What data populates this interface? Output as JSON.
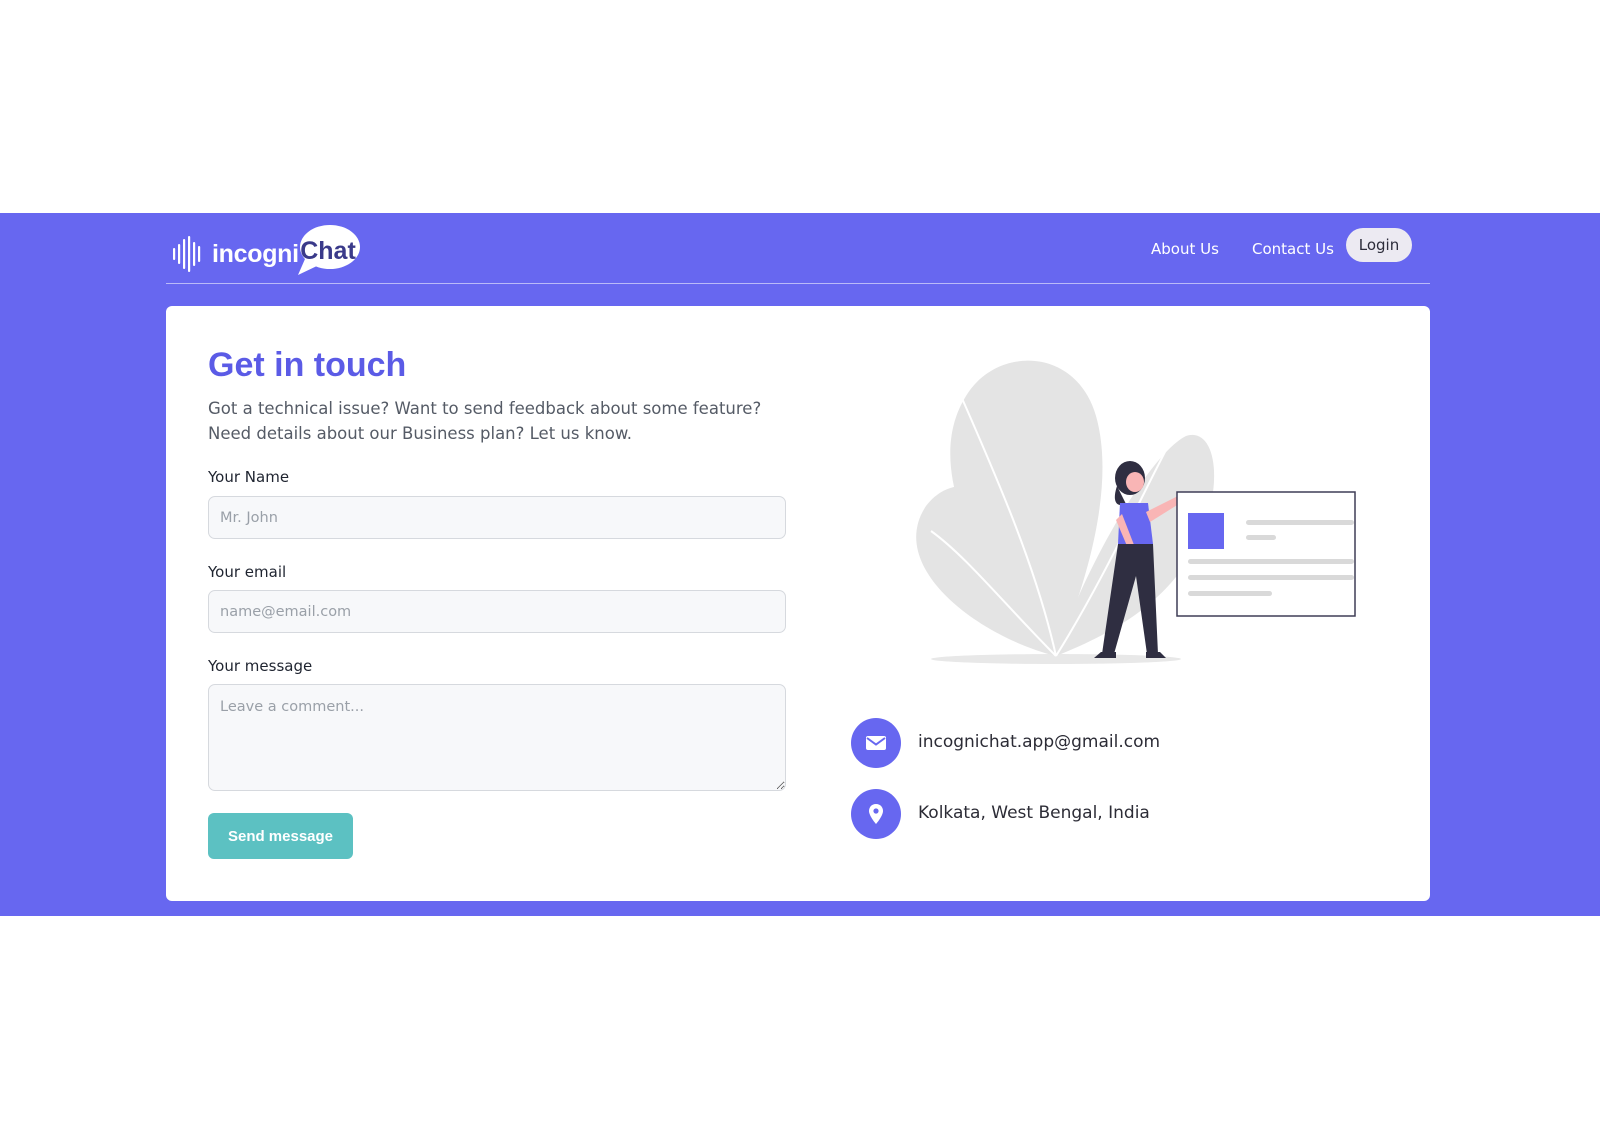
{
  "colors": {
    "brand": "#6767f0",
    "heading": "#5b5be6",
    "send_button": "#5cc1c2",
    "login_button_bg": "#eceaf2"
  },
  "header": {
    "logo": {
      "text_part1": "incogni",
      "text_part2": "Chat"
    },
    "nav": {
      "about": "About Us",
      "contact": "Contact Us"
    },
    "login_label": "Login"
  },
  "contact_form": {
    "title": "Get in touch",
    "description": "Got a technical issue? Want to send feedback about some feature? Need details about our Business plan? Let us know.",
    "name": {
      "label": "Your Name",
      "placeholder": "Mr. John",
      "value": ""
    },
    "email": {
      "label": "Your email",
      "placeholder": "name@email.com",
      "value": ""
    },
    "message": {
      "label": "Your message",
      "placeholder": "Leave a comment...",
      "value": ""
    },
    "submit_label": "Send message"
  },
  "contact_info": {
    "email": {
      "icon": "mail-icon",
      "text": "incognichat.app@gmail.com"
    },
    "location": {
      "icon": "map-pin-icon",
      "text": "Kolkata, West Bengal, India"
    }
  }
}
